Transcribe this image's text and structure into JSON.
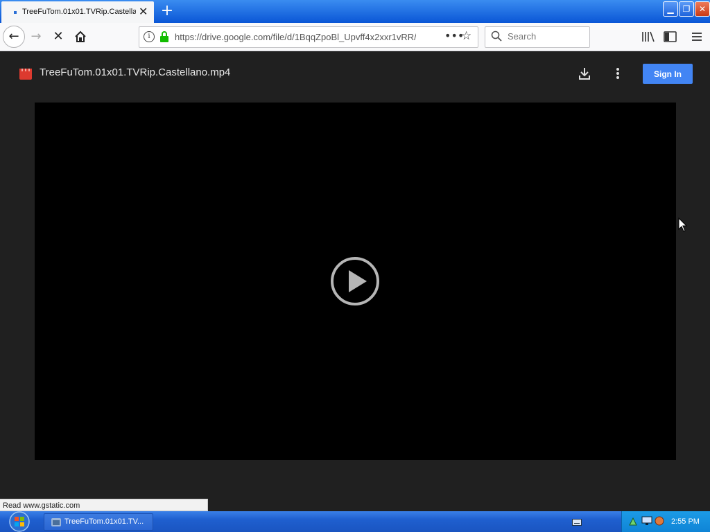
{
  "browser": {
    "tab_title": "TreeFuTom.01x01.TVRip.Castellano.mp4",
    "new_tab_symbol": "+",
    "url": "https://drive.google.com/file/d/1BqqZpoBl_Upvff4x2xxr1vRR/",
    "search_placeholder": "Search",
    "status_text": "Read www.gstatic.com"
  },
  "drive": {
    "file_name": "TreeFuTom.01x01.TVRip.Castellano.mp4",
    "sign_in_label": "Sign In",
    "accent_color": "#4285f4",
    "file_icon_color": "#dc3a2f"
  },
  "taskbar": {
    "window_label": "TreeFuTom.01x01.TV...",
    "clock": "2:55 PM"
  },
  "icons": [
    "back-icon",
    "forward-icon",
    "stop-icon",
    "home-icon",
    "info-icon",
    "lock-icon",
    "page-actions-icon",
    "bookmark-star-icon",
    "search-icon",
    "library-icon",
    "sidebar-icon",
    "hamburger-menu-icon",
    "video-file-icon",
    "download-icon",
    "more-vert-icon",
    "play-icon",
    "windows-start-icon",
    "keyboard-icon",
    "network-icon",
    "volume-icon"
  ]
}
